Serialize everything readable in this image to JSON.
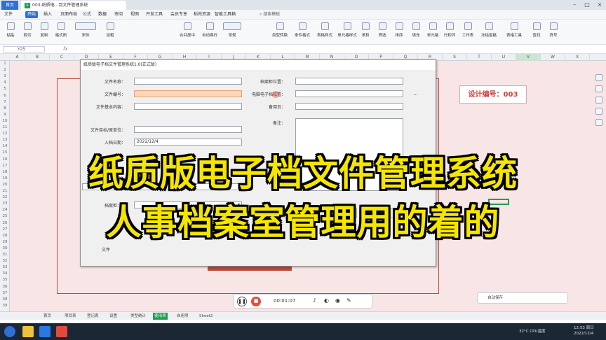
{
  "app": {
    "tabs": [
      {
        "label": "首页"
      },
      {
        "label": "003-纸质电...到文件管理系统",
        "icon": "S"
      }
    ],
    "window_controls": [
      "minimize-icon",
      "maximize-icon",
      "close-icon"
    ]
  },
  "menubar": {
    "items": [
      "文件",
      "开始",
      "插入",
      "页面布局",
      "公式",
      "数据",
      "审阅",
      "视图",
      "开发工具",
      "会员专享",
      "稻壳资源",
      "智能工具箱"
    ],
    "active": "开始",
    "search": "搜索模板"
  },
  "ribbon": {
    "buttons": [
      "粘贴",
      "剪切",
      "复制",
      "格式刷",
      "宋体",
      "加粗",
      "合并居中",
      "自动换行",
      "常规",
      "类型转换",
      "条件格式",
      "表格样式",
      "单元格样式",
      "求和",
      "筛选",
      "排序",
      "填充",
      "单元格",
      "行和列",
      "工作表",
      "冻结窗格",
      "表格工具",
      "查找",
      "符号"
    ]
  },
  "formula_bar": {
    "name_box": "Y25",
    "fx": "fx"
  },
  "columns": [
    "A",
    "B",
    "C",
    "D",
    "E",
    "F",
    "G",
    "H",
    "I",
    "J",
    "K",
    "L",
    "M",
    "N",
    "O",
    "P",
    "Q",
    "R",
    "S",
    "T",
    "U",
    "V",
    "W",
    "X"
  ],
  "selected_column": "V",
  "rows": [
    "1",
    "2",
    "3",
    "4",
    "5",
    "6",
    "7",
    "8",
    "9",
    "10",
    "11",
    "12",
    "13",
    "14",
    "15",
    "16",
    "17",
    "18",
    "19",
    "20",
    "21",
    "22",
    "23",
    "24",
    "25",
    "26",
    "27",
    "28",
    "29",
    "30",
    "31",
    "32",
    "33",
    "34",
    "35",
    "36",
    "37",
    "38",
    "39"
  ],
  "design_label": "设计编号：003",
  "dialog": {
    "title": "纸质版电子档文件管理系统1.0(正式版)",
    "fields_left": [
      {
        "label": "文件名称：",
        "value": ""
      },
      {
        "label": "文件编号：",
        "value": ""
      },
      {
        "label": "文件基本内容：",
        "value": ""
      },
      {
        "label": "文件目标/原单位：",
        "value": ""
      },
      {
        "label": "入档日期：",
        "value": "2022/12/4"
      }
    ],
    "fields_right": [
      {
        "label": "档案柜位置：",
        "value": ""
      },
      {
        "label": "电脑电子档位置：",
        "value": ""
      },
      {
        "label": "备用页：",
        "value": ""
      },
      {
        "label": "备注：",
        "value": ""
      }
    ],
    "lower_labels": [
      "档案柜：",
      "文件"
    ],
    "more": "..."
  },
  "overlay": {
    "line1": "纸质版电子档文件管理系统",
    "line2": "人事档案室管理用的着的"
  },
  "player": {
    "time": "00:01:07"
  },
  "autosave": {
    "label": "自动保存"
  },
  "sheet_tabs": [
    "首页",
    "项目表",
    "登记表",
    "设置",
    "类型统计",
    "使用项",
    "自用项",
    "Sheet2"
  ],
  "active_sheet": "使用项",
  "tray": {
    "temp": "32°C",
    "cpu": "CPU温度",
    "time": "12:53",
    "weekday": "周日",
    "date": "2022/12/4"
  },
  "colors": {
    "accent": "#1f9d55",
    "overlay_text": "#f5e600",
    "sheet_bg": "#f8e6e6",
    "highlight_field": "#fbd7b8"
  }
}
